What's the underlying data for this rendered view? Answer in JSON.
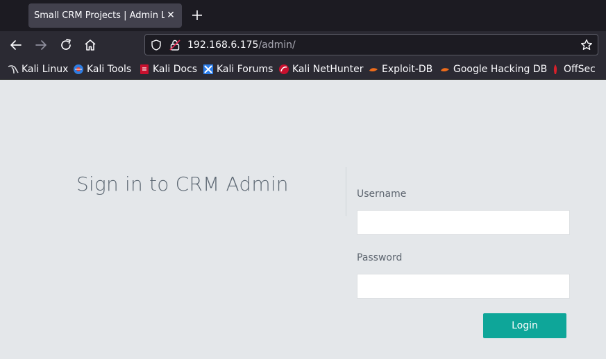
{
  "tab": {
    "title": "Small CRM Projects | Admin Login",
    "close_icon": "close-icon",
    "new_tab_icon": "plus-icon"
  },
  "nav": {
    "back_icon": "arrow-left-icon",
    "forward_icon": "arrow-right-icon",
    "reload_icon": "reload-icon",
    "home_icon": "home-icon",
    "url_host": "192.168.6.175",
    "url_path": "/admin/",
    "shield_icon": "shield-icon",
    "lock_icon": "insecure-lock-icon",
    "bookmark_icon": "star-icon"
  },
  "bookmarks": [
    {
      "label": "Kali Linux",
      "icon": "kali-dragon-icon"
    },
    {
      "label": "Kali Tools",
      "icon": "kali-tools-icon"
    },
    {
      "label": "Kali Docs",
      "icon": "kali-docs-icon"
    },
    {
      "label": "Kali Forums",
      "icon": "kali-forums-icon"
    },
    {
      "label": "Kali NetHunter",
      "icon": "nethunter-icon"
    },
    {
      "label": "Exploit-DB",
      "icon": "exploit-db-icon"
    },
    {
      "label": "Google Hacking DB",
      "icon": "ghdb-icon"
    },
    {
      "label": "OffSec",
      "icon": "offsec-icon"
    }
  ],
  "page": {
    "title": "Sign in to CRM Admin",
    "username_label": "Username",
    "username_value": "",
    "password_label": "Password",
    "password_value": "",
    "login_label": "Login"
  },
  "colors": {
    "page_bg": "#e4e7ea",
    "accent": "#0ea699",
    "toolbar": "#2b2a33",
    "tabstrip": "#1c1b22"
  }
}
